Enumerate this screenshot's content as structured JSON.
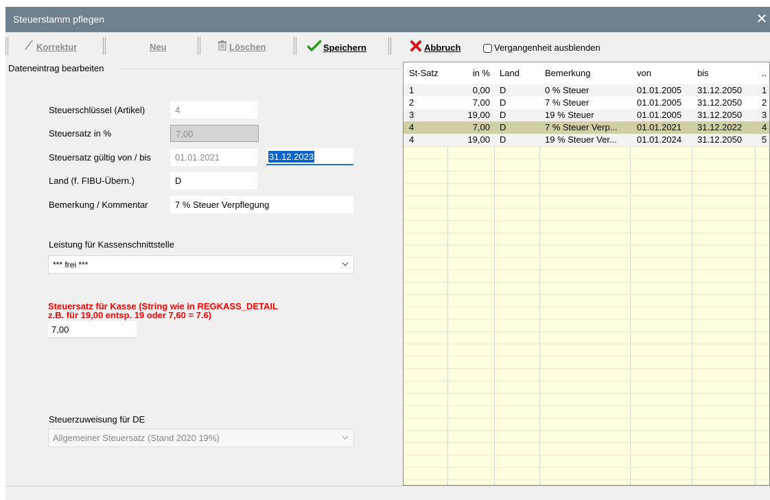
{
  "window": {
    "title": "Steuerstamm pflegen",
    "close": "✕"
  },
  "toolbar": {
    "korrektur": "Korrektur",
    "neu": "Neu",
    "loeschen": "Löschen",
    "speichern": "Speichern",
    "abbruch": "Abbruch",
    "hide_past_label": "Vergangenheit ausblenden",
    "hide_past_checked": false
  },
  "form": {
    "group_title": "Dateneintrag bearbeiten",
    "key_label": "Steuerschlüssel (Artikel)",
    "key_value": "4",
    "rate_label": "Steuersatz in %",
    "rate_value": "7,00",
    "valid_label": "Steuersatz gültig von / bis",
    "valid_from": "01.01.2021",
    "valid_to": "31.12.2023",
    "country_label": "Land (f. FIBU-Übern.)",
    "country_value": "D",
    "comment_label": "Bemerkung / Kommentar",
    "comment_value": "7 % Steuer Verpflegung",
    "service_label": "Leistung für Kassenschnittstelle",
    "service_value": "*** frei ***",
    "cash_label_1": "Steuersatz für Kasse (String wie in REGKASS_DETAIL",
    "cash_label_2": "z.B. für 19,00 entsp. 19 oder 7,60 = 7.6)",
    "cash_value": "7,00",
    "de_label": "Steuerzuweisung für DE",
    "de_value": "Allgemeiner Steuersatz (Stand 2020 19%)"
  },
  "grid": {
    "columns": [
      "St-Satz",
      "in %",
      "Land",
      "Bemerkung",
      "von",
      "bis",
      ".."
    ],
    "rows": [
      [
        "1",
        "0,00",
        "D",
        "0 % Steuer",
        "01.01.2005",
        "31.12.2050",
        "1"
      ],
      [
        "2",
        "7,00",
        "D",
        "7 % Steuer",
        "01.01.2005",
        "31.12.2050",
        "2"
      ],
      [
        "3",
        "19,00",
        "D",
        "19 % Steuer",
        "01.01.2005",
        "31.12.2050",
        "3"
      ],
      [
        "4",
        "7,00",
        "D",
        "7 % Steuer Verp...",
        "01.01.2021",
        "31.12.2022",
        "4"
      ],
      [
        "4",
        "19,00",
        "D",
        "19 % Steuer Ver...",
        "01.01.2024",
        "31.12.2050",
        "5"
      ]
    ],
    "selected_row": 3
  },
  "colors": {
    "title_bar": "#707f8c",
    "grid_bg": "#ffffe0",
    "selected_row": "#d0cfa4",
    "required_label": "#ff0000",
    "selection": "#0a64c8"
  },
  "icons": {
    "korrektur": "wand-icon",
    "loeschen": "trash-icon",
    "speichern": "checkmark-icon",
    "abbruch": "x-cancel-icon",
    "close": "close-icon"
  }
}
